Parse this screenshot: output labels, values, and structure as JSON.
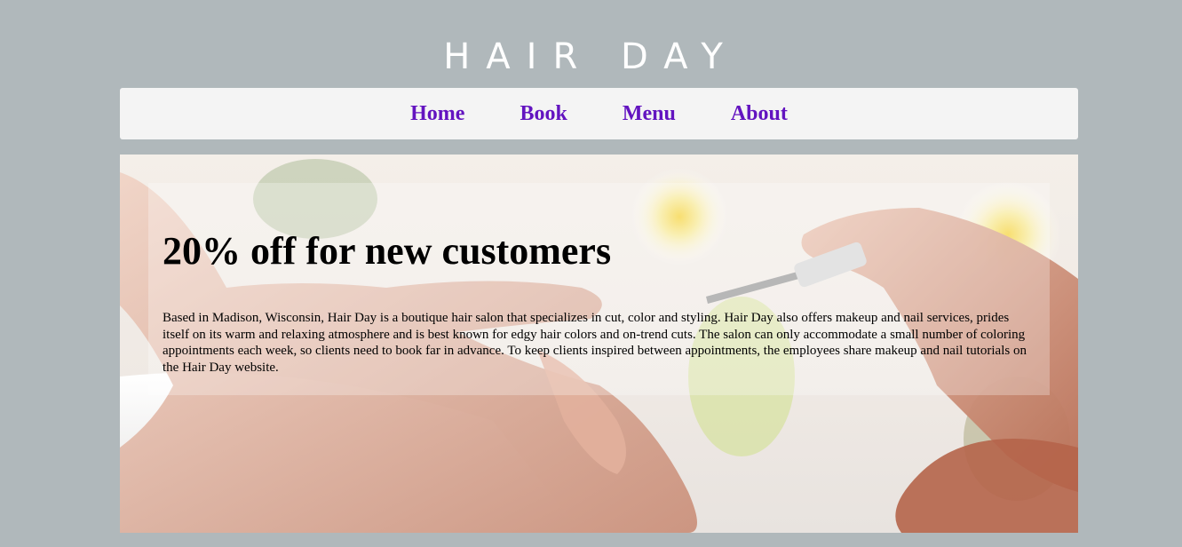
{
  "site": {
    "title": "HAIR DAY"
  },
  "nav": {
    "items": [
      {
        "label": "Home"
      },
      {
        "label": "Book"
      },
      {
        "label": "Menu"
      },
      {
        "label": "About"
      }
    ]
  },
  "hero": {
    "image": "nail-manicure-photo",
    "headline": "20% off for new customers",
    "body": "Based in Madison, Wisconsin, Hair Day is a boutique hair salon that specializes in cut, color and styling. Hair Day also offers makeup and nail services, prides itself on its warm and relaxing atmosphere and is best known for edgy hair colors and on-trend cuts. The salon can only accommodate a small number of coloring appointments each week, so clients need to book far in advance. To keep clients inspired between appointments, the employees share makeup and nail tutorials on the Hair Day website."
  },
  "colors": {
    "page_background": "#b0b8bb",
    "nav_background": "#f4f4f4",
    "nav_link": "#6314c0",
    "title": "#ffffff"
  }
}
